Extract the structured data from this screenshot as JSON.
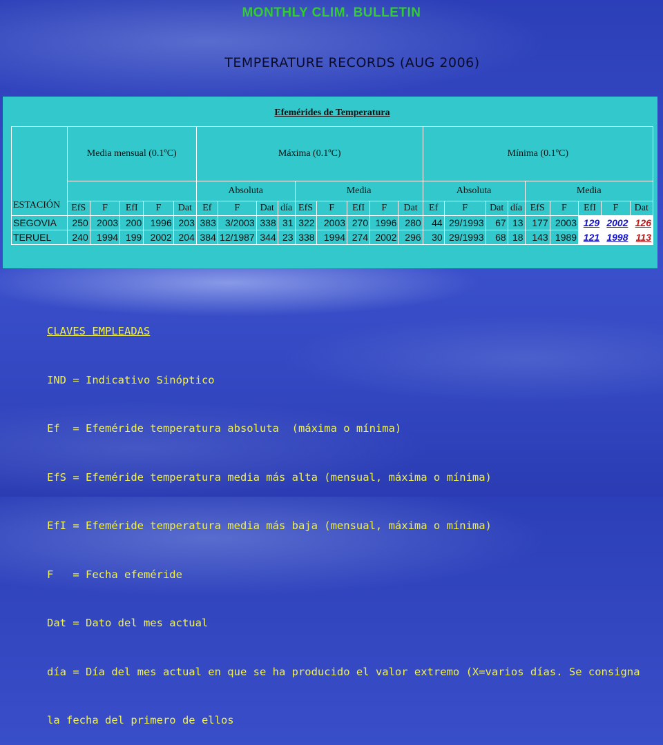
{
  "title": "MONTHLY CLIM. BULLETIN",
  "subtitle": "TEMPERATURE RECORDS  (AUG 2006)",
  "table": {
    "caption": "Efemérides de Temperatura",
    "station_label": "ESTACIÓN",
    "groups": {
      "media_mensual": "Media mensual (0.1ºC)",
      "maxima": "Máxima (0.1ºC)",
      "minima": "Mínima (0.1ºC)"
    },
    "subgroups": {
      "max_abs": "Absoluta",
      "max_media": "Media",
      "min_abs": "Absoluta",
      "min_media": "Media"
    },
    "cols": [
      "EfS",
      "F",
      "EfI",
      "F",
      "Dat",
      "Ef",
      "F",
      "Dat",
      "día",
      "EfS",
      "F",
      "EfI",
      "F",
      "Dat",
      "Ef",
      "F",
      "Dat",
      "día",
      "EfS",
      "F",
      "EfI",
      "F",
      "Dat"
    ],
    "rows": [
      {
        "station": "SEGOVIA",
        "values": [
          "250",
          "2003",
          "200",
          "1996",
          "203",
          "383",
          "3/2003",
          "338",
          "31",
          "322",
          "2003",
          "270",
          "1996",
          "280",
          "44",
          "29/1993",
          "67",
          "13",
          "177",
          "2003",
          "129",
          "2002",
          "126"
        ]
      },
      {
        "station": "TERUEL",
        "values": [
          "240",
          "1994",
          "199",
          "2002",
          "204",
          "384",
          "12/1987",
          "344",
          "23",
          "338",
          "1994",
          "274",
          "2002",
          "296",
          "30",
          "29/1993",
          "68",
          "18",
          "143",
          "1989",
          "121",
          "1998",
          "113"
        ]
      }
    ]
  },
  "legend": {
    "heading": "CLAVES EMPLEADAS",
    "lines": [
      "IND = Indicativo Sinóptico",
      "Ef  = Efeméride temperatura absoluta  (máxima o mínima)",
      "EfS = Efeméride temperatura media más alta (mensual, máxima o mínima)",
      "EfI = Efeméride temperatura media más baja (mensual, máxima o mínima)",
      "F   = Fecha efeméride",
      "Dat = Dato del mes actual",
      "día = Día del mes actual en que se ha producido el valor extremo (X=varios días. Se consigna",
      "la fecha del primero de ellos"
    ]
  },
  "colors": {
    "title": "#33cc33",
    "panel": "#33c9cc",
    "legend": "#f2f24a",
    "highlight_blue": "#1414c8",
    "highlight_red": "#c01a1a"
  }
}
